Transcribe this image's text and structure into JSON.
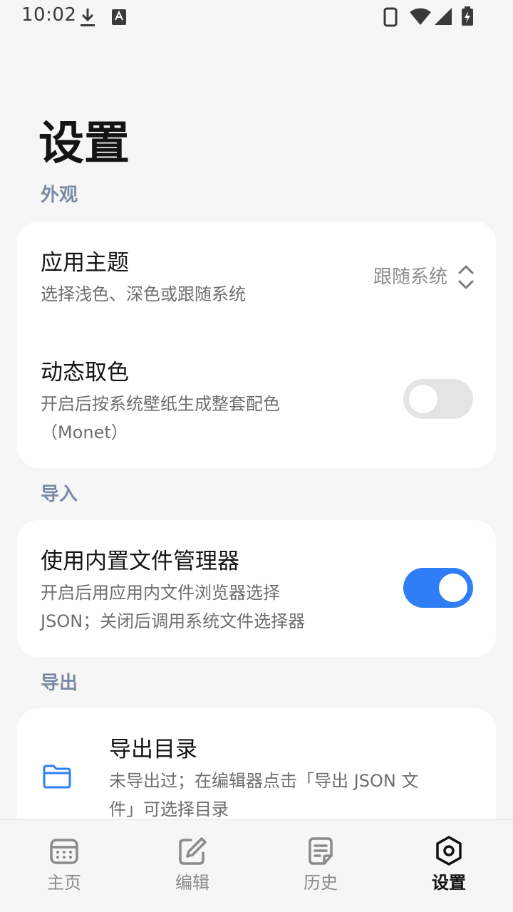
{
  "status_bar": {
    "time": "10:02"
  },
  "page": {
    "title": "设置"
  },
  "sections": {
    "appearance": {
      "label": "外观",
      "theme": {
        "title": "应用主题",
        "subtitle": "选择浅色、深色或跟随系统",
        "value": "跟随系统"
      },
      "dynamic_color": {
        "title": "动态取色",
        "subtitle_line1": "开启后按系统壁纸生成整套配色",
        "subtitle_line2": "（Monet）",
        "enabled": false
      }
    },
    "import": {
      "label": "导入",
      "builtin_file_manager": {
        "title": "使用内置文件管理器",
        "subtitle_line1": "开启后用应用内文件浏览器选择",
        "subtitle_line2": "JSON；关闭后调用系统文件选择器",
        "enabled": true
      }
    },
    "export": {
      "label": "导出",
      "directory": {
        "title": "导出目录",
        "subtitle_line1": "未导出过；在编辑器点击「导出 JSON 文",
        "subtitle_line2": "件」可选择目录"
      }
    }
  },
  "bottom_nav": {
    "items": [
      {
        "label": "主页",
        "icon": "calendar-icon",
        "active": false
      },
      {
        "label": "编辑",
        "icon": "edit-icon",
        "active": false
      },
      {
        "label": "历史",
        "icon": "document-icon",
        "active": false
      },
      {
        "label": "设置",
        "icon": "settings-icon",
        "active": true
      }
    ]
  },
  "colors": {
    "accent": "#2f7ef5",
    "section_label": "#7b8aa4",
    "background": "#f6f6f6",
    "card": "#ffffff"
  }
}
